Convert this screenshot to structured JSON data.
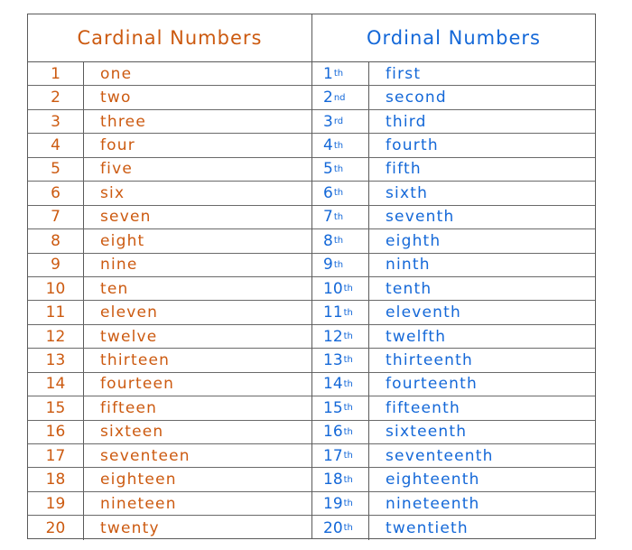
{
  "cardinal": {
    "title": "Cardinal Numbers",
    "color": "#cc5a10",
    "rows": [
      {
        "num": "1",
        "word": "one"
      },
      {
        "num": "2",
        "word": "two"
      },
      {
        "num": "3",
        "word": "three"
      },
      {
        "num": "4",
        "word": "four"
      },
      {
        "num": "5",
        "word": "five"
      },
      {
        "num": "6",
        "word": "six"
      },
      {
        "num": "7",
        "word": "seven"
      },
      {
        "num": "8",
        "word": "eight"
      },
      {
        "num": "9",
        "word": "nine"
      },
      {
        "num": "10",
        "word": "ten"
      },
      {
        "num": "11",
        "word": "eleven"
      },
      {
        "num": "12",
        "word": "twelve"
      },
      {
        "num": "13",
        "word": "thirteen"
      },
      {
        "num": "14",
        "word": "fourteen"
      },
      {
        "num": "15",
        "word": "fifteen"
      },
      {
        "num": "16",
        "word": "sixteen"
      },
      {
        "num": "17",
        "word": "seventeen"
      },
      {
        "num": "18",
        "word": "eighteen"
      },
      {
        "num": "19",
        "word": "nineteen"
      },
      {
        "num": "20",
        "word": "twenty"
      }
    ]
  },
  "ordinal": {
    "title": "Ordinal Numbers",
    "color": "#1468d8",
    "rows": [
      {
        "num": "1",
        "suffix": "th",
        "word": "first"
      },
      {
        "num": "2",
        "suffix": "nd",
        "word": "second"
      },
      {
        "num": "3",
        "suffix": "rd",
        "word": "third"
      },
      {
        "num": "4",
        "suffix": "th",
        "word": "fourth"
      },
      {
        "num": "5",
        "suffix": "th",
        "word": "fifth"
      },
      {
        "num": "6",
        "suffix": "th",
        "word": "sixth"
      },
      {
        "num": "7",
        "suffix": "th",
        "word": "seventh"
      },
      {
        "num": "8",
        "suffix": "th",
        "word": "eighth"
      },
      {
        "num": "9",
        "suffix": "th",
        "word": "ninth"
      },
      {
        "num": "10",
        "suffix": "th",
        "word": "tenth"
      },
      {
        "num": "11",
        "suffix": "th",
        "word": "eleventh"
      },
      {
        "num": "12",
        "suffix": "th",
        "word": "twelfth"
      },
      {
        "num": "13",
        "suffix": "th",
        "word": "thirteenth"
      },
      {
        "num": "14",
        "suffix": "th",
        "word": "fourteenth"
      },
      {
        "num": "15",
        "suffix": "th",
        "word": "fifteenth"
      },
      {
        "num": "16",
        "suffix": "th",
        "word": "sixteenth"
      },
      {
        "num": "17",
        "suffix": "th",
        "word": "seventeenth"
      },
      {
        "num": "18",
        "suffix": "th",
        "word": "eighteenth"
      },
      {
        "num": "19",
        "suffix": "th",
        "word": "nineteenth"
      },
      {
        "num": "20",
        "suffix": "th",
        "word": "twentieth"
      }
    ]
  }
}
